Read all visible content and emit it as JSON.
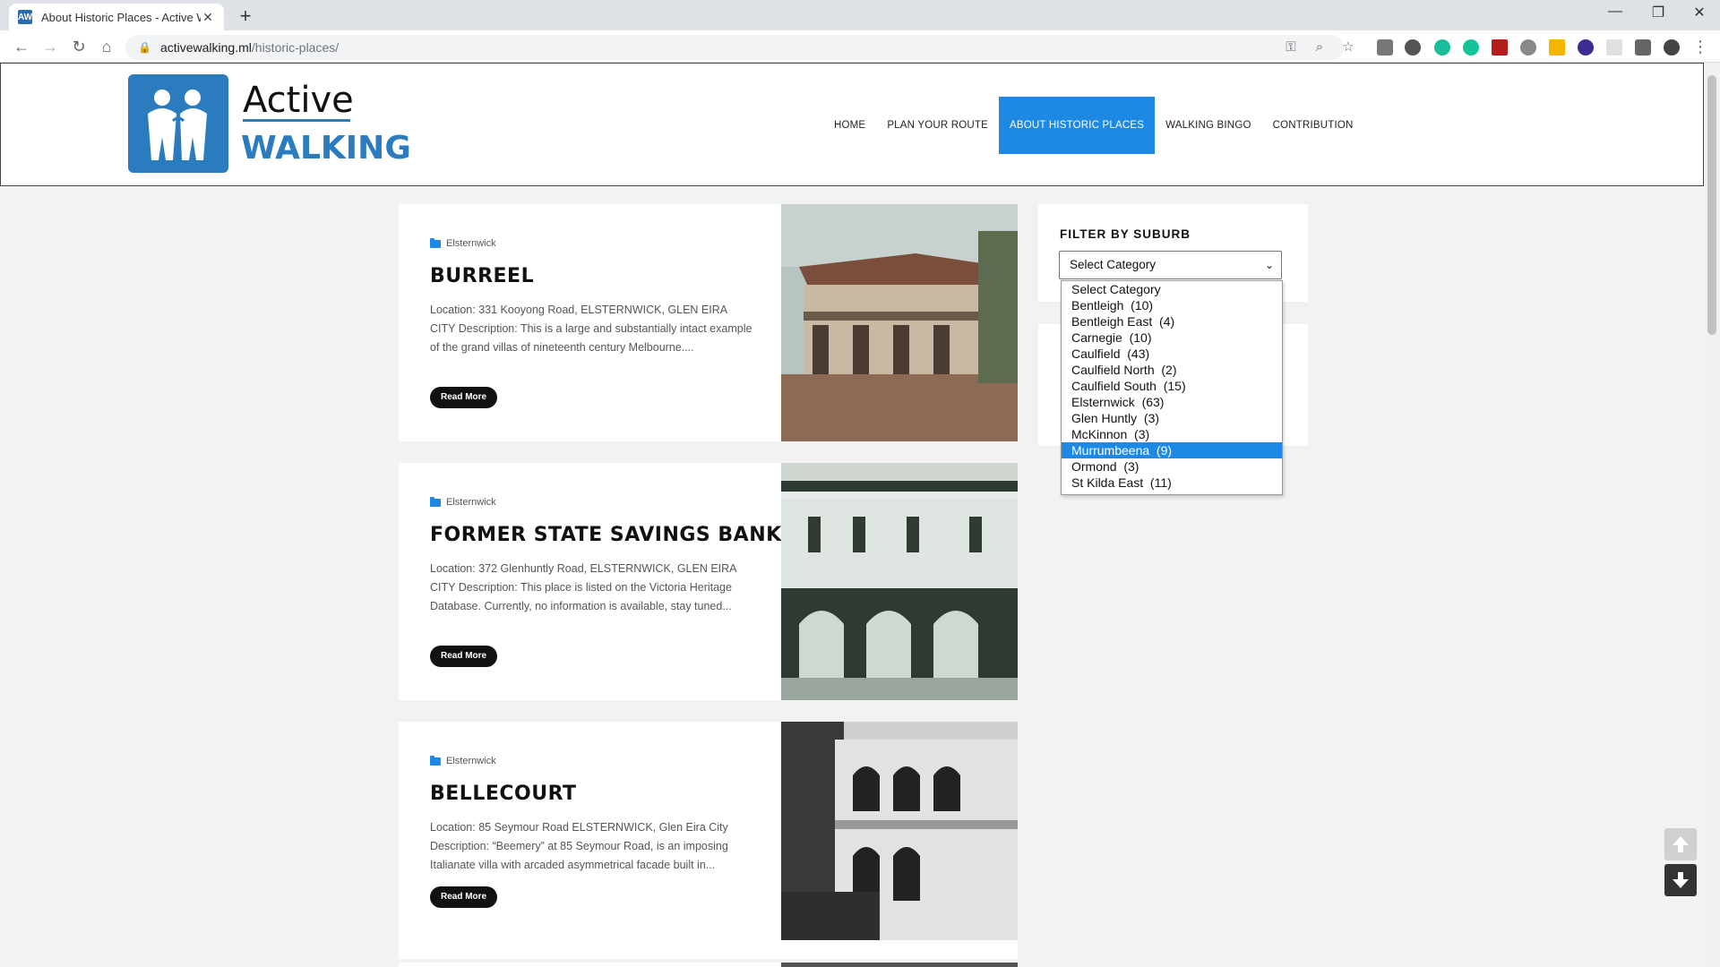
{
  "browser": {
    "tab_title": "About Historic Places - Active Wa",
    "tab_close": "✕",
    "new_tab": "+",
    "url_host": "activewalking.ml",
    "url_path": "/historic-places/",
    "win_minimize": "—",
    "win_restore": "❐",
    "win_close": "✕"
  },
  "site": {
    "brand_top": "Active",
    "brand_bottom": "WALKING",
    "nav": [
      "HOME",
      "PLAN YOUR ROUTE",
      "ABOUT HISTORIC PLACES",
      "WALKING BINGO",
      "CONTRIBUTION"
    ],
    "active_nav": "ABOUT HISTORIC PLACES"
  },
  "posts": [
    {
      "category": "Elsternwick",
      "title": "BURREEL",
      "excerpt": "Location: 331 Kooyong Road, ELSTERNWICK, GLEN EIRA CITY Description: This is a large and substantially intact example of the grand villas of nineteenth century Melbourne....",
      "read_more": "Read More"
    },
    {
      "category": "Elsternwick",
      "title": "FORMER STATE SAVINGS BANK",
      "excerpt": "Location: 372 Glenhuntly Road, ELSTERNWICK, GLEN EIRA CITY Description: This place is listed on the Victoria Heritage Database. Currently, no information is available, stay tuned...",
      "read_more": "Read More"
    },
    {
      "category": "Elsternwick",
      "title": "BELLECOURT",
      "excerpt": "Location: 85 Seymour Road ELSTERNWICK, Glen Eira City Description: “Beemery” at 85 Seymour Road, is an imposing Italianate villa with arcaded asymmetrical facade built in...",
      "read_more": "Read More"
    }
  ],
  "sidebar": {
    "filter_title": "FILTER BY SUBURB",
    "select_value": "Select Category",
    "options": [
      "Select Category",
      "Bentleigh  (10)",
      "Bentleigh East  (4)",
      "Carnegie  (10)",
      "Caulfield  (43)",
      "Caulfield North  (2)",
      "Caulfield South  (15)",
      "Elsternwick  (63)",
      "Glen Huntly  (3)",
      "McKinnon  (3)",
      "Murrumbeena  (9)",
      "Ormond  (3)",
      "St Kilda East  (11)"
    ],
    "highlighted_option": "Murrumbeena  (9)"
  },
  "colors": {
    "accent": "#1e88e5",
    "brand_blue": "#2b7bbf"
  }
}
